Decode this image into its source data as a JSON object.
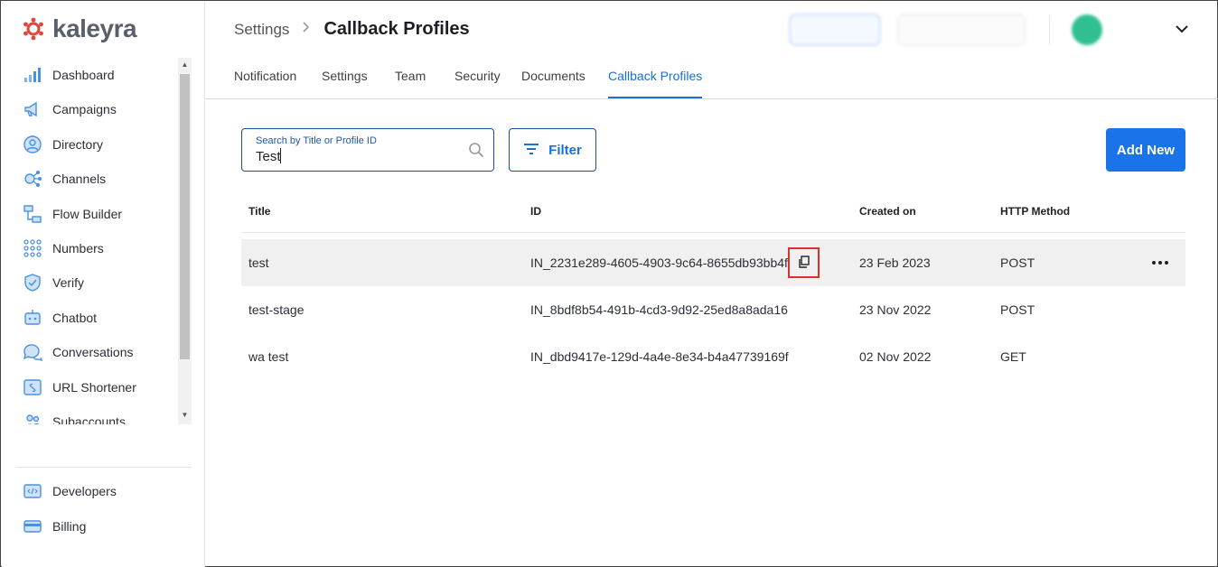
{
  "brand": {
    "name": "kaleyra"
  },
  "sidebar": {
    "items": [
      {
        "label": "Dashboard",
        "icon": "dashboard-icon"
      },
      {
        "label": "Campaigns",
        "icon": "megaphone-icon"
      },
      {
        "label": "Directory",
        "icon": "contact-icon"
      },
      {
        "label": "Channels",
        "icon": "channels-icon"
      },
      {
        "label": "Flow Builder",
        "icon": "flow-icon"
      },
      {
        "label": "Numbers",
        "icon": "numbers-grid-icon"
      },
      {
        "label": "Verify",
        "icon": "shield-check-icon"
      },
      {
        "label": "Chatbot",
        "icon": "chatbot-icon"
      },
      {
        "label": "Conversations",
        "icon": "chat-bubbles-icon"
      },
      {
        "label": "URL Shortener",
        "icon": "link-icon"
      },
      {
        "label": "Subaccounts",
        "icon": "users-icon"
      }
    ],
    "bottom_items": [
      {
        "label": "Developers",
        "icon": "code-icon"
      },
      {
        "label": "Billing",
        "icon": "card-icon"
      }
    ]
  },
  "header": {
    "breadcrumb_parent": "Settings",
    "breadcrumb_separator": ">",
    "title": "Callback Profiles"
  },
  "tabs": [
    {
      "label": "Notification"
    },
    {
      "label": "Settings"
    },
    {
      "label": "Team"
    },
    {
      "label": "Security"
    },
    {
      "label": "Documents"
    },
    {
      "label": "Callback Profiles",
      "active": true
    }
  ],
  "search": {
    "placeholder": "Search by Title or Profile ID",
    "value": "Test"
  },
  "filter_label": "Filter",
  "add_new_label": "Add New",
  "table": {
    "columns": [
      "Title",
      "ID",
      "Created on",
      "HTTP Method"
    ],
    "rows": [
      {
        "title": "test",
        "id": "IN_2231e289-4605-4903-9c64-8655db93bb4f",
        "created": "23 Feb 2023",
        "method": "POST",
        "highlighted": true
      },
      {
        "title": "test-stage",
        "id": "IN_8bdf8b54-491b-4cd3-9d92-25ed8a8ada16",
        "created": "23 Nov 2022",
        "method": "POST"
      },
      {
        "title": "wa test",
        "id": "IN_dbd9417e-129d-4a4e-8e34-b4a47739169f",
        "created": "02 Nov 2022",
        "method": "GET"
      }
    ]
  },
  "colors": {
    "accent": "#1a73e8",
    "icon_blue": "#4a90e2",
    "highlight_box": "#d6322b",
    "row_highlight": "#f0f0f0"
  }
}
